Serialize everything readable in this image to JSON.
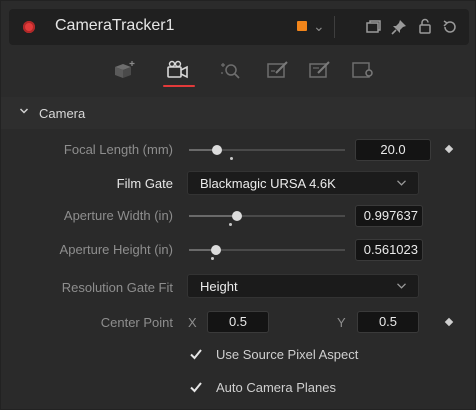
{
  "header": {
    "title": "CameraTracker1",
    "node_color": "#f2851a"
  },
  "toolbar": {
    "tabs": [
      {
        "icon": "track-tab-icon"
      },
      {
        "icon": "camera-tab-icon",
        "active": true
      },
      {
        "icon": "options-tab-icon"
      },
      {
        "icon": "refine-tab-icon"
      },
      {
        "icon": "export-tab-icon"
      },
      {
        "icon": "settings-tab-icon"
      }
    ],
    "active_color": "#e23a3a"
  },
  "section": {
    "label": "Camera"
  },
  "fields": {
    "focal_length": {
      "label": "Focal Length (mm)",
      "value": "20.0",
      "level": 0.15
    },
    "film_gate": {
      "label": "Film Gate",
      "value": "Blackmagic URSA 4.6K"
    },
    "aperture_width": {
      "label": "Aperture Width (in)",
      "value": "0.997637",
      "level": 0.3
    },
    "aperture_height": {
      "label": "Aperture Height (in)",
      "value": "0.561023",
      "level": 0.16
    },
    "resolution_gate_fit": {
      "label": "Resolution Gate Fit",
      "value": "Height"
    },
    "center_point": {
      "label": "Center Point",
      "x_label": "X",
      "x_value": "0.5",
      "y_label": "Y",
      "y_value": "0.5"
    },
    "use_source_pixel_aspect": {
      "label": "Use Source Pixel Aspect",
      "checked": true
    },
    "auto_camera_planes": {
      "label": "Auto Camera Planes",
      "checked": true
    }
  }
}
